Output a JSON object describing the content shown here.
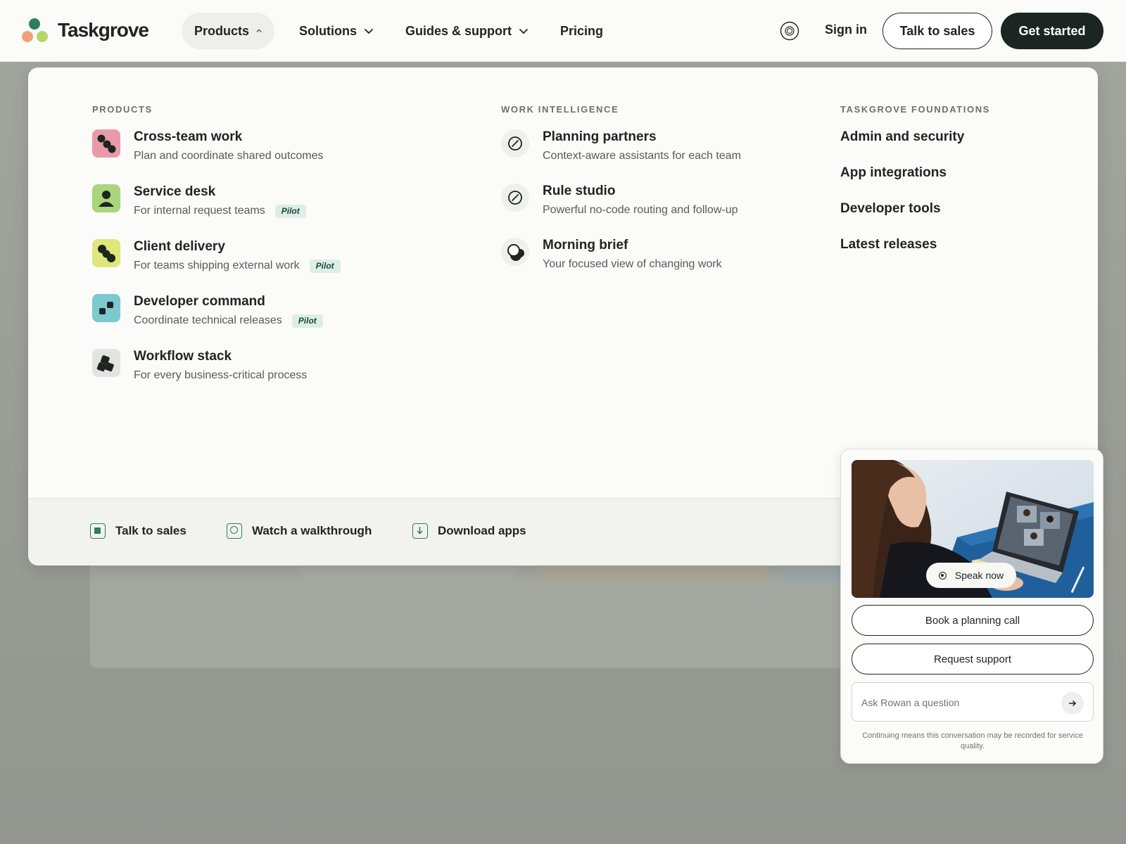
{
  "brand": {
    "name": "Taskgrove"
  },
  "nav": {
    "items": [
      {
        "label": "Products",
        "expanded": true
      },
      {
        "label": "Solutions"
      },
      {
        "label": "Guides & support"
      },
      {
        "label": "Pricing"
      }
    ],
    "sign_in": "Sign in",
    "talk_to_sales": "Talk to sales",
    "get_started": "Get started"
  },
  "menu": {
    "products": {
      "heading": "PRODUCTS",
      "items": [
        {
          "title": "Cross-team work",
          "desc": "Plan and coordinate shared outcomes",
          "icon": "cross-team-icon",
          "color": "#e99aa8"
        },
        {
          "title": "Service desk",
          "desc": "For internal request teams",
          "badge": "Pilot",
          "icon": "person-icon",
          "color": "#a9d67a"
        },
        {
          "title": "Client delivery",
          "desc": "For teams shipping external work",
          "badge": "Pilot",
          "icon": "delivery-icon",
          "color": "#dfe77a"
        },
        {
          "title": "Developer command",
          "desc": "Coordinate technical releases",
          "badge": "Pilot",
          "icon": "developer-icon",
          "color": "#7cc9d0"
        },
        {
          "title": "Workflow stack",
          "desc": "For every business-critical process",
          "icon": "stack-icon",
          "color": "#e2e4e0"
        }
      ]
    },
    "intelligence": {
      "heading": "WORK INTELLIGENCE",
      "items": [
        {
          "title": "Planning partners",
          "desc": "Context-aware assistants for each team",
          "icon": "compass-icon"
        },
        {
          "title": "Rule studio",
          "desc": "Powerful no-code routing and follow-up",
          "icon": "compass-icon"
        },
        {
          "title": "Morning brief",
          "desc": "Your focused view of changing work",
          "icon": "brief-icon"
        }
      ]
    },
    "foundations": {
      "heading": "TASKGROVE FOUNDATIONS",
      "links": [
        "Admin and security",
        "App integrations",
        "Developer tools",
        "Latest releases"
      ]
    },
    "footer": {
      "links": [
        {
          "label": "Talk to sales",
          "icon": "sales-icon"
        },
        {
          "label": "Watch a walkthrough",
          "icon": "video-icon"
        },
        {
          "label": "Download apps",
          "icon": "download-icon"
        }
      ]
    }
  },
  "chat": {
    "speak_now": "Speak now",
    "book_call": "Book a planning call",
    "request_support": "Request support",
    "input_placeholder": "Ask Rowan a question",
    "disclaimer": "Continuing means this conversation may be recorded for service quality."
  },
  "colors": {
    "brand_green": "#2e7d5b",
    "dark": "#1b2622",
    "pill_bg": "#dcefe6"
  }
}
